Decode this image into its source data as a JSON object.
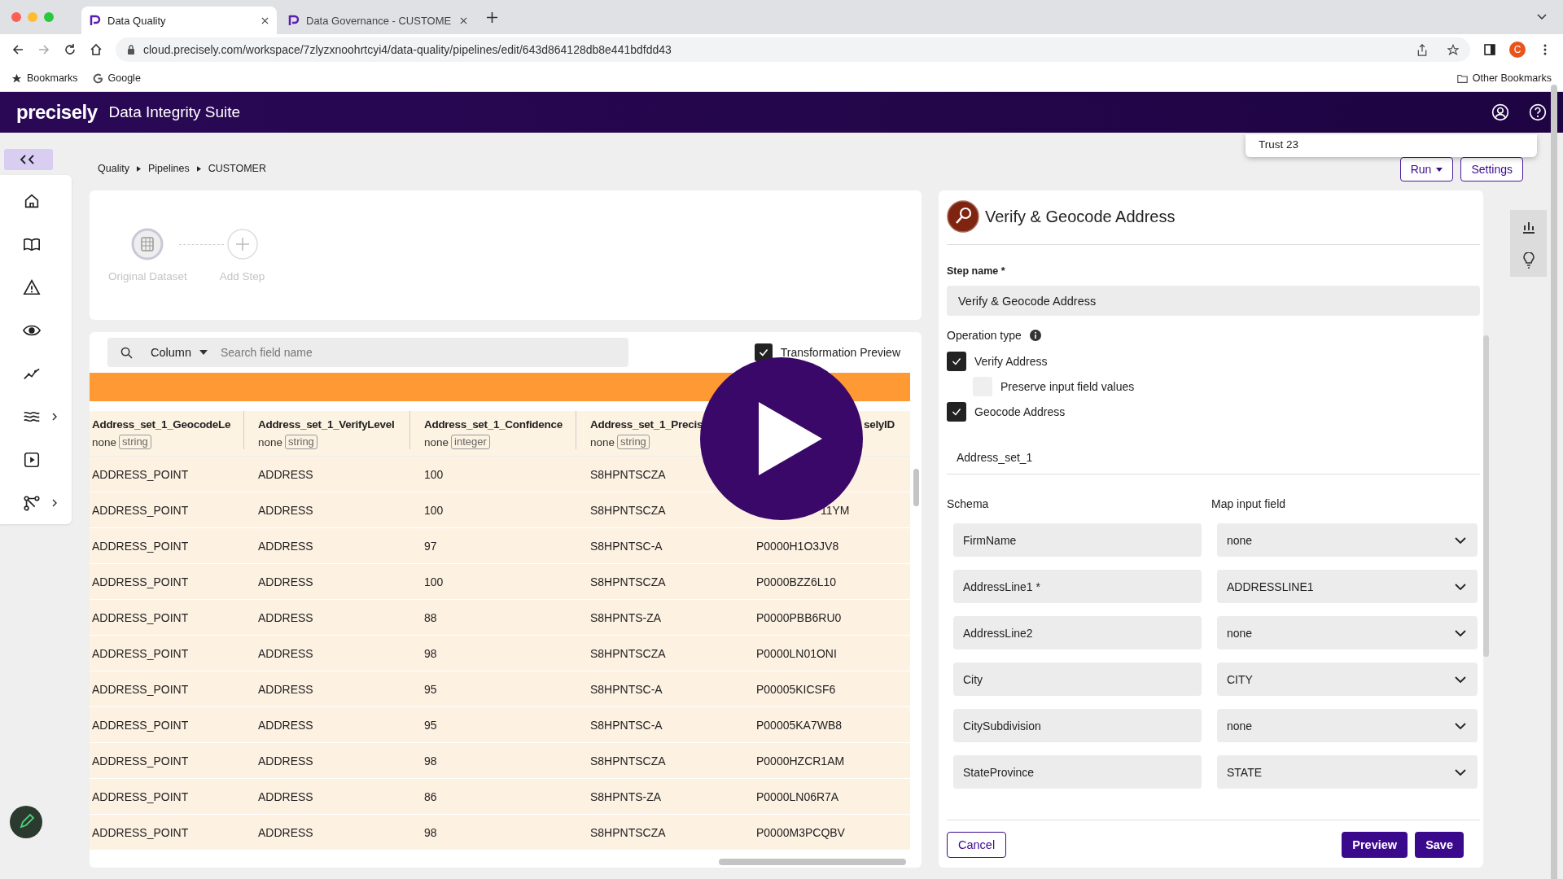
{
  "browser": {
    "tabs": [
      {
        "title": "Data Quality",
        "selected": true
      },
      {
        "title": "Data Governance - CUSTOME",
        "selected": false
      }
    ],
    "url": "cloud.precisely.com/workspace/7zlyzxnoohrtcyi4/data-quality/pipelines/edit/643d864128db8e441bdfdd43",
    "avatar": "C",
    "bookmarks": [
      {
        "label": "Bookmarks",
        "kind": "star"
      },
      {
        "label": "Google",
        "kind": "google"
      }
    ],
    "other_bookmarks": "Other Bookmarks"
  },
  "app": {
    "logo": "precisely",
    "title": "Data Integrity Suite"
  },
  "account_menu": {
    "item": "Trust 23"
  },
  "breadcrumb": [
    "Quality",
    "Pipelines",
    "CUSTOMER"
  ],
  "actions": [
    {
      "label": "Run",
      "kind": "dropdown"
    },
    {
      "label": "Settings",
      "kind": "plain"
    }
  ],
  "sidebar": {
    "items": [
      {
        "kind": "home",
        "expandable": false
      },
      {
        "kind": "book",
        "expandable": false
      },
      {
        "kind": "warning",
        "expandable": false
      },
      {
        "kind": "eye",
        "expandable": false
      },
      {
        "kind": "trend",
        "expandable": false
      },
      {
        "kind": "waves",
        "expandable": true
      },
      {
        "kind": "play",
        "expandable": false
      },
      {
        "kind": "network",
        "expandable": true
      }
    ]
  },
  "pipeline": {
    "steps": [
      {
        "label": "Original Dataset",
        "kind": "dataset"
      },
      {
        "label": "Add Step",
        "kind": "add"
      }
    ]
  },
  "table": {
    "search": {
      "filter": "Column",
      "placeholder": "Search field name"
    },
    "transformation_preview": {
      "label": "Transformation Preview",
      "checked": true
    },
    "columns": [
      {
        "name": "Address_set_1_GeocodeLe",
        "prefix": "none",
        "type": "string"
      },
      {
        "name": "Address_set_1_VerifyLevel",
        "prefix": "none",
        "type": "string"
      },
      {
        "name": "Address_set_1_Confidence",
        "prefix": "none",
        "type": "integer"
      },
      {
        "name": "Address_set_1_Precis",
        "prefix": "none",
        "type": "string"
      },
      {
        "name": "selyID"
      }
    ],
    "rows": [
      [
        "ADDRESS_POINT",
        "ADDRESS",
        "100",
        "S8HPNTSCZA"
      ],
      [
        "ADDRESS_POINT",
        "ADDRESS",
        "100",
        "S8HPNTSCZA",
        "11YM"
      ],
      [
        "ADDRESS_POINT",
        "ADDRESS",
        "97",
        "S8HPNTSC-A",
        "P0000H1O3JV8"
      ],
      [
        "ADDRESS_POINT",
        "ADDRESS",
        "100",
        "S8HPNTSCZA",
        "P0000BZZ6L10"
      ],
      [
        "ADDRESS_POINT",
        "ADDRESS",
        "88",
        "S8HPNTS-ZA",
        "P0000PBB6RU0"
      ],
      [
        "ADDRESS_POINT",
        "ADDRESS",
        "98",
        "S8HPNTSCZA",
        "P0000LN01ONI"
      ],
      [
        "ADDRESS_POINT",
        "ADDRESS",
        "95",
        "S8HPNTSC-A",
        "P00005KICSF6"
      ],
      [
        "ADDRESS_POINT",
        "ADDRESS",
        "95",
        "S8HPNTSC-A",
        "P00005KA7WB8"
      ],
      [
        "ADDRESS_POINT",
        "ADDRESS",
        "98",
        "S8HPNTSCZA",
        "P0000HZCR1AM"
      ],
      [
        "ADDRESS_POINT",
        "ADDRESS",
        "86",
        "S8HPNTS-ZA",
        "P0000LN06R7A"
      ],
      [
        "ADDRESS_POINT",
        "ADDRESS",
        "98",
        "S8HPNTSCZA",
        "P0000M3PCQBV"
      ]
    ]
  },
  "step_panel": {
    "title": "Verify & Geocode Address",
    "step_name_label": "Step name *",
    "step_name": "Verify & Geocode Address",
    "operation_label": "Operation type",
    "options": [
      {
        "label": "Verify Address",
        "checked": true,
        "nested": false
      },
      {
        "label": "Preserve input field values",
        "checked": false,
        "nested": true
      },
      {
        "label": "Geocode Address",
        "checked": true,
        "nested": false
      }
    ],
    "output_prefix": "Address_set_1",
    "schema_label": "Schema",
    "map_label": "Map input field",
    "mappings": [
      {
        "schema": "FirmName",
        "input": "none"
      },
      {
        "schema": "AddressLine1 *",
        "input": "ADDRESSLINE1"
      },
      {
        "schema": "AddressLine2",
        "input": "none"
      },
      {
        "schema": "City",
        "input": "CITY"
      },
      {
        "schema": "CitySubdivision",
        "input": "none"
      },
      {
        "schema": "StateProvince",
        "input": "STATE"
      }
    ],
    "buttons": [
      {
        "label": "Cancel",
        "kind": "secondary"
      },
      {
        "label": "Preview",
        "kind": "primary"
      },
      {
        "label": "Save",
        "kind": "primary"
      }
    ]
  }
}
